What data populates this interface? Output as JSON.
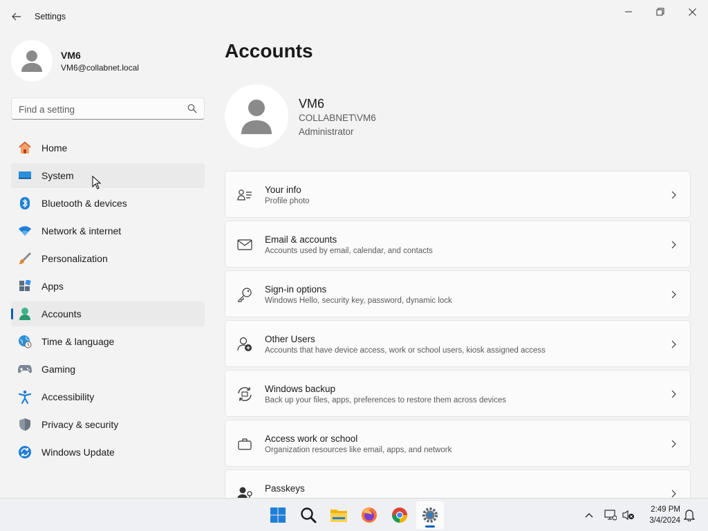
{
  "window": {
    "app_title": "Settings"
  },
  "sidebar": {
    "user": {
      "name": "VM6",
      "email": "VM6@collabnet.local"
    },
    "search": {
      "placeholder": "Find a setting"
    },
    "items": [
      {
        "label": "Home",
        "icon": "home-icon"
      },
      {
        "label": "System",
        "icon": "system-icon"
      },
      {
        "label": "Bluetooth & devices",
        "icon": "bluetooth-icon"
      },
      {
        "label": "Network & internet",
        "icon": "network-icon"
      },
      {
        "label": "Personalization",
        "icon": "brush-icon"
      },
      {
        "label": "Apps",
        "icon": "apps-icon"
      },
      {
        "label": "Accounts",
        "icon": "accounts-icon"
      },
      {
        "label": "Time & language",
        "icon": "globe-clock-icon"
      },
      {
        "label": "Gaming",
        "icon": "gamepad-icon"
      },
      {
        "label": "Accessibility",
        "icon": "accessibility-icon"
      },
      {
        "label": "Privacy & security",
        "icon": "shield-icon"
      },
      {
        "label": "Windows Update",
        "icon": "update-icon"
      }
    ],
    "selected": "Accounts",
    "hovered": "System"
  },
  "main": {
    "title": "Accounts",
    "profile": {
      "name": "VM6",
      "domain": "COLLABNET\\VM6",
      "role": "Administrator"
    },
    "cards": [
      {
        "title": "Your info",
        "subtitle": "Profile photo",
        "icon": "person-info-icon"
      },
      {
        "title": "Email & accounts",
        "subtitle": "Accounts used by email, calendar, and contacts",
        "icon": "mail-icon"
      },
      {
        "title": "Sign-in options",
        "subtitle": "Windows Hello, security key, password, dynamic lock",
        "icon": "key-icon"
      },
      {
        "title": "Other Users",
        "subtitle": "Accounts that have device access, work or school users, kiosk assigned access",
        "icon": "person-add-icon"
      },
      {
        "title": "Windows backup",
        "subtitle": "Back up your files, apps, preferences to restore them across devices",
        "icon": "backup-icon"
      },
      {
        "title": "Access work or school",
        "subtitle": "Organization resources like email, apps, and network",
        "icon": "briefcase-icon"
      },
      {
        "title": "Passkeys",
        "subtitle": "",
        "icon": "passkey-icon"
      }
    ]
  },
  "taskbar": {
    "apps": [
      "start-icon",
      "search-icon",
      "file-explorer-icon",
      "firefox-icon",
      "chrome-icon",
      "settings-icon"
    ],
    "active_app": "settings-icon",
    "clock": {
      "time": "2:49 PM",
      "date": "3/4/2024"
    }
  },
  "colors": {
    "accent": "#005fb8",
    "background": "#f3f3f3",
    "card": "#fbfbfb"
  }
}
